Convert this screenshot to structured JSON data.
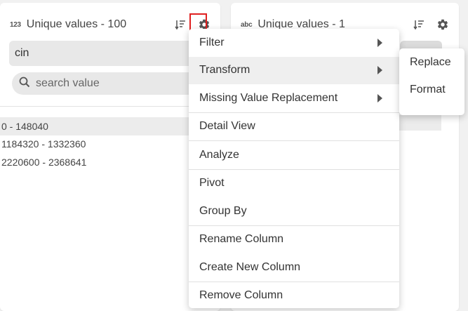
{
  "left_panel": {
    "type_icon": "123",
    "header_title": "Unique values - 100",
    "column_name": "cin",
    "search_placeholder": "search value",
    "values": [
      "0 - 148040",
      "1184320 - 1332360",
      "2220600 - 2368641"
    ]
  },
  "right_panel": {
    "type_icon": "abc",
    "header_title": "Unique values - 1"
  },
  "menu": {
    "groups": [
      [
        {
          "label": "Filter",
          "submenu": true
        },
        {
          "label": "Transform",
          "submenu": true,
          "active": true
        },
        {
          "label": "Missing Value Replacement",
          "submenu": true
        }
      ],
      [
        {
          "label": "Detail View"
        }
      ],
      [
        {
          "label": "Analyze"
        }
      ],
      [
        {
          "label": "Pivot"
        },
        {
          "label": "Group By"
        }
      ],
      [
        {
          "label": "Rename Column"
        },
        {
          "label": "Create New Column"
        }
      ],
      [
        {
          "label": "Remove Column"
        }
      ]
    ]
  },
  "submenu": {
    "items": [
      "Replace",
      "Format"
    ]
  },
  "icons": {
    "sort": "sort-icon",
    "gear": "gear-icon",
    "search": "search-icon"
  },
  "colors": {
    "highlight_border": "#e02020",
    "active_item_bg": "#efefef"
  }
}
